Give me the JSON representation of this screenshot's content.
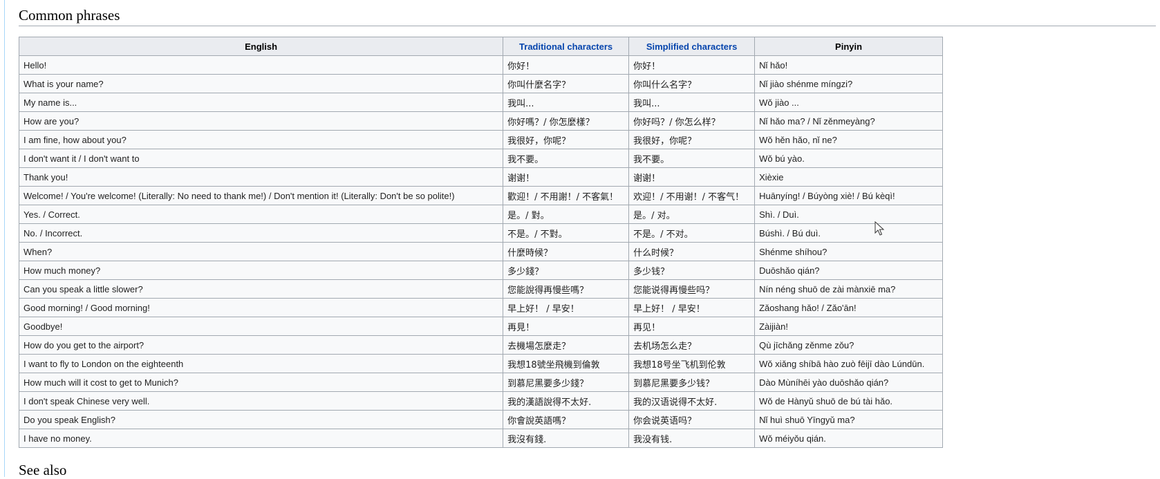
{
  "sections": {
    "common_phrases_heading": "Common phrases",
    "see_also_heading": "See also"
  },
  "table": {
    "headers": {
      "english": "English",
      "traditional": "Traditional characters",
      "simplified": "Simplified characters",
      "pinyin": "Pinyin"
    },
    "rows": [
      {
        "english": "Hello!",
        "traditional": "你好！",
        "simplified": "你好！",
        "pinyin": "Nǐ hǎo!"
      },
      {
        "english": "What is your name?",
        "traditional": "你叫什麼名字？",
        "simplified": "你叫什么名字？",
        "pinyin": "Nǐ jiào shénme míngzi?"
      },
      {
        "english": "My name is...",
        "traditional": "我叫...",
        "simplified": "我叫...",
        "pinyin": "Wǒ jiào ..."
      },
      {
        "english": "How are you?",
        "traditional": "你好嗎？/ 你怎麼樣？",
        "simplified": "你好吗？/ 你怎么样？",
        "pinyin": "Nǐ hǎo ma? / Nǐ zěnmeyàng?"
      },
      {
        "english": "I am fine, how about you?",
        "traditional": "我很好，你呢？",
        "simplified": "我很好，你呢？",
        "pinyin": "Wǒ hěn hǎo, nǐ ne?"
      },
      {
        "english": "I don't want it / I don't want to",
        "traditional": "我不要。",
        "simplified": "我不要。",
        "pinyin": "Wǒ bú yào."
      },
      {
        "english": "Thank you!",
        "traditional": "谢谢！",
        "simplified": "谢谢！",
        "pinyin": "Xièxie"
      },
      {
        "english": "Welcome! / You're welcome! (Literally: No need to thank me!) / Don't mention it! (Literally: Don't be so polite!)",
        "traditional": "歡迎！/ 不用謝！/ 不客氣！",
        "simplified": "欢迎！/ 不用谢！/ 不客气！",
        "pinyin": "Huānyíng! / Búyòng xiè! / Bú kèqì!"
      },
      {
        "english": "Yes. / Correct.",
        "traditional": "是。/ 對。",
        "simplified": "是。/ 对。",
        "pinyin": "Shì. / Duì."
      },
      {
        "english": "No. / Incorrect.",
        "traditional": "不是。/ 不對。",
        "simplified": "不是。/ 不对。",
        "pinyin": "Búshì. / Bú duì."
      },
      {
        "english": "When?",
        "traditional": "什麼時候？",
        "simplified": "什么时候？",
        "pinyin": "Shénme shíhou?"
      },
      {
        "english": "How much money?",
        "traditional": "多少錢？",
        "simplified": "多少钱？",
        "pinyin": "Duōshǎo qián?"
      },
      {
        "english": "Can you speak a little slower?",
        "traditional": "您能說得再慢些嗎？",
        "simplified": "您能说得再慢些吗？",
        "pinyin": "Nín néng shuō de zài mànxiē ma?"
      },
      {
        "english": "Good morning! / Good morning!",
        "traditional": "早上好！ / 早安！",
        "simplified": "早上好！ / 早安！",
        "pinyin": "Zǎoshang hǎo! / Zǎo'ān!"
      },
      {
        "english": "Goodbye!",
        "traditional": "再見！",
        "simplified": "再见！",
        "pinyin": "Zàijiàn!"
      },
      {
        "english": "How do you get to the airport?",
        "traditional": "去機場怎麼走？",
        "simplified": "去机场怎么走？",
        "pinyin": "Qù jīchǎng zěnme zǒu?"
      },
      {
        "english": "I want to fly to London on the eighteenth",
        "traditional": "我想18號坐飛機到倫敦",
        "simplified": "我想18号坐飞机到伦敦",
        "pinyin": "Wǒ xiǎng shíbā hào zuò fēijī dào Lúndūn."
      },
      {
        "english": "How much will it cost to get to Munich?",
        "traditional": "到慕尼黑要多少錢？",
        "simplified": "到慕尼黑要多少钱？",
        "pinyin": "Dào Mùníhēi yào duōshǎo qián?"
      },
      {
        "english": "I don't speak Chinese very well.",
        "traditional": "我的漢語說得不太好.",
        "simplified": "我的汉语说得不太好.",
        "pinyin": "Wǒ de Hànyǔ shuō de bú tài hǎo."
      },
      {
        "english": "Do you speak English?",
        "traditional": "你會說英語嗎？",
        "simplified": "你会说英语吗？",
        "pinyin": "Nǐ huì shuō Yīngyǔ ma?"
      },
      {
        "english": "I have no money.",
        "traditional": "我沒有錢.",
        "simplified": "我没有钱.",
        "pinyin": "Wǒ méiyǒu qián."
      }
    ]
  },
  "colors": {
    "link": "#3366cc",
    "border": "#a2a9b1",
    "header_bg": "#eaecf0",
    "cell_bg": "#f8f9fa"
  },
  "icons": [
    "mouse-cursor-icon"
  ]
}
